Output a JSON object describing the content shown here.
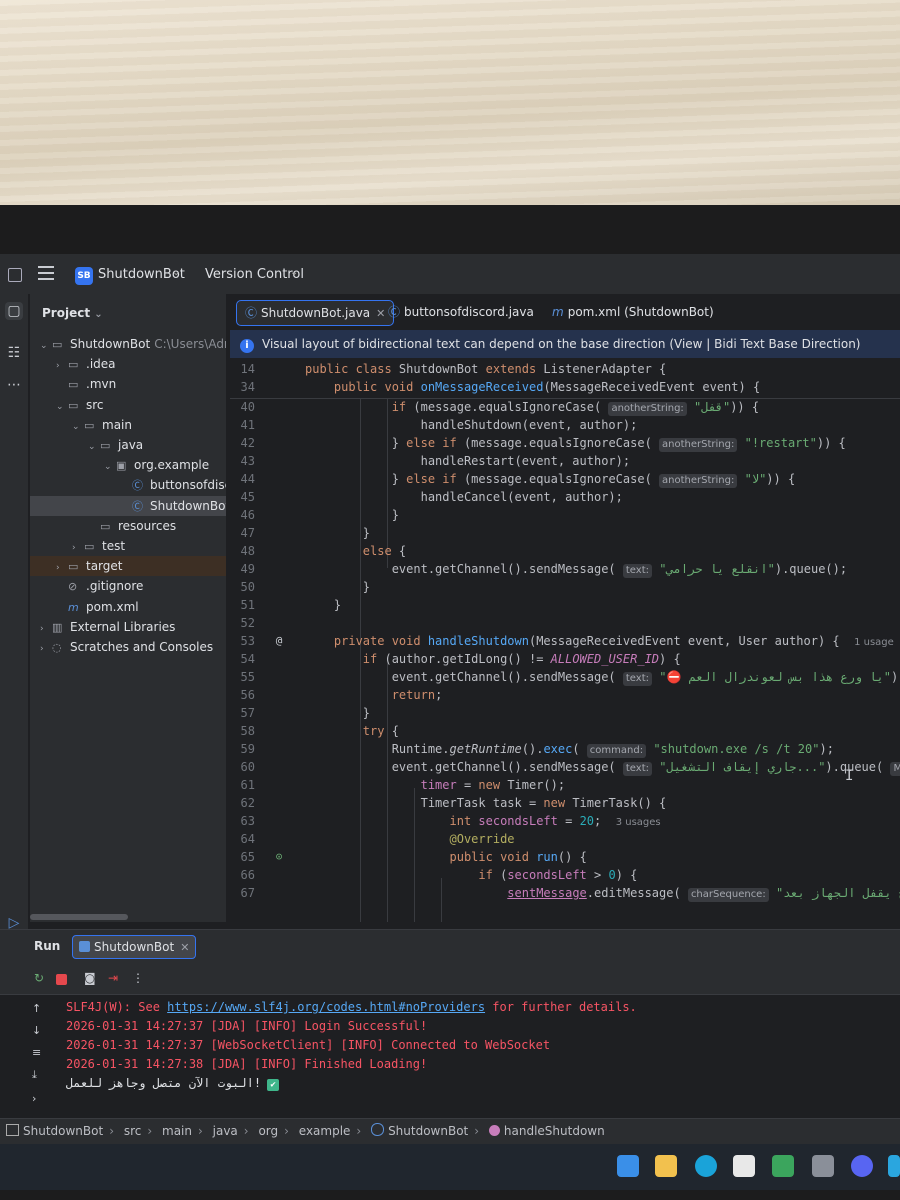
{
  "titlebar": {
    "project_badge": "SB",
    "project_name": "ShutdownBot",
    "version_control": "Version Control"
  },
  "project_panel": {
    "title": "Project",
    "tree": [
      {
        "label": "ShutdownBot",
        "path": "C:\\Users\\Adm",
        "icon": "folder-icon",
        "arrow": "down",
        "indent": 0
      },
      {
        "label": ".idea",
        "icon": "folder-icon",
        "arrow": "right",
        "indent": 1
      },
      {
        "label": ".mvn",
        "icon": "folder-icon",
        "arrow": "",
        "indent": 1
      },
      {
        "label": "src",
        "icon": "folder-icon",
        "arrow": "down",
        "indent": 1
      },
      {
        "label": "main",
        "icon": "folder-icon",
        "arrow": "down",
        "indent": 2
      },
      {
        "label": "java",
        "icon": "folder-icon",
        "arrow": "down",
        "indent": 3
      },
      {
        "label": "org.example",
        "icon": "package-icon",
        "arrow": "down",
        "indent": 4
      },
      {
        "label": "buttonsofdiscord",
        "icon": "class-icon",
        "arrow": "",
        "indent": 5
      },
      {
        "label": "ShutdownBot",
        "icon": "class-icon",
        "arrow": "",
        "indent": 5,
        "selected": true
      },
      {
        "label": "resources",
        "icon": "folder-icon",
        "arrow": "",
        "indent": 3
      },
      {
        "label": "test",
        "icon": "folder-icon",
        "arrow": "right",
        "indent": 2
      },
      {
        "label": "target",
        "icon": "folder-icon",
        "arrow": "right",
        "indent": 1,
        "target": true
      },
      {
        "label": ".gitignore",
        "icon": "ignore-icon",
        "arrow": "",
        "indent": 1
      },
      {
        "label": "pom.xml",
        "icon": "maven-icon",
        "arrow": "",
        "indent": 1
      },
      {
        "label": "External Libraries",
        "icon": "library-icon",
        "arrow": "right",
        "indent": 0
      },
      {
        "label": "Scratches and Consoles",
        "icon": "scratch-icon",
        "arrow": "right",
        "indent": 0
      }
    ]
  },
  "editor": {
    "tabs": [
      {
        "label": "ShutdownBot.java",
        "active": true
      },
      {
        "label": "buttonsofdiscord.java",
        "active": false
      },
      {
        "label": "pom.xml (ShutdownBot)",
        "active": false
      }
    ],
    "banner": "Visual layout of bidirectional text can depend on the base direction (View | Bidi Text Base Direction)",
    "hints": {
      "another_string": "anotherString:",
      "text": "text:",
      "command": "command:",
      "char_sequence": "charSequence:",
      "message_partial": "Messag",
      "usage_1": "1 usage",
      "usage_3": "3 usages"
    },
    "strings": {
      "cancel_partial": "\"قفل\"",
      "restart": "\"!restart\"",
      "la": "\"لا\"",
      "thief": "\"انقلع يا حرامي\"",
      "owner_only": "\"⛔ يا ورع هذا بس لعوندرال العم\"",
      "shutdown_cmd": "\"shutdown.exe /s /t 20\"",
      "shutting_down": "\"جاري إيقاف التشغيل...\"",
      "countdown": "\"راح يقفل الجهاز بعد: \""
    },
    "line_numbers": {
      "sticky": [
        "14",
        "34"
      ],
      "code": [
        "40",
        "41",
        "42",
        "43",
        "44",
        "45",
        "46",
        "47",
        "48",
        "49",
        "50",
        "51",
        "52",
        "53",
        "54",
        "55",
        "56",
        "57",
        "58",
        "59",
        "60",
        "61",
        "62",
        "63",
        "64",
        "65",
        "66",
        "67"
      ]
    }
  },
  "run_panel": {
    "title": "Run",
    "tab_label": "ShutdownBot",
    "console": [
      {
        "type": "err",
        "prefix": "SLF4J(W): See ",
        "link": "https://www.slf4j.org/codes.html#noProviders",
        "suffix": " for further details."
      },
      {
        "type": "err",
        "text": "2026-01-31 14:27:37 [JDA] [INFO] Login Successful!"
      },
      {
        "type": "err",
        "text": "2026-01-31 14:27:37 [WebSocketClient] [INFO] Connected to WebSocket"
      },
      {
        "type": "err",
        "text": "2026-01-31 14:27:38 [JDA] [INFO] Finished Loading!"
      },
      {
        "type": "out",
        "text": "البوت الآن متصل وجاهز للعمل!",
        "badge": "✔"
      }
    ]
  },
  "breadcrumb": [
    "ShutdownBot",
    "src",
    "main",
    "java",
    "org",
    "example",
    "ShutdownBot",
    "handleShutdown"
  ],
  "colors": {
    "accent": "#3574f0",
    "keyword": "#cf8e6d",
    "function": "#56a8f5",
    "string": "#6aab73",
    "number": "#2aacb8",
    "field": "#c77dbb",
    "error": "#f75464"
  }
}
